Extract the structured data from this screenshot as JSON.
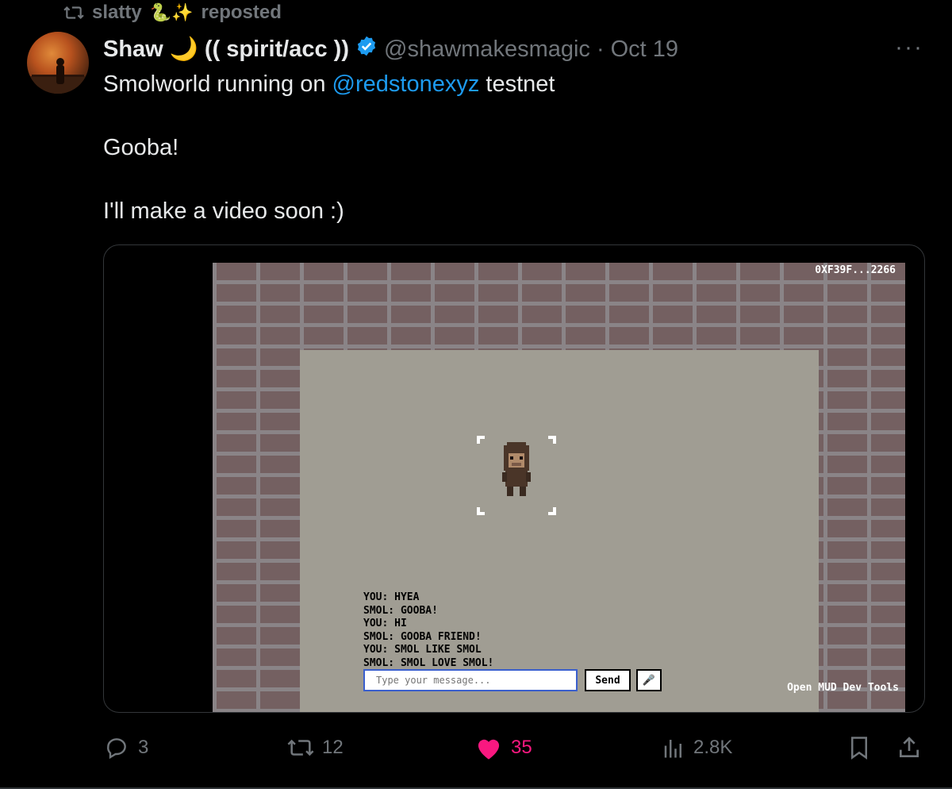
{
  "repost": {
    "user": "slatty",
    "emoji": "🐍✨",
    "label": "reposted"
  },
  "author": {
    "name": "Shaw",
    "name_suffix": "🌙 (( spirit/acc ))",
    "handle": "@shawmakesmagic",
    "separator": "·",
    "date": "Oct 19"
  },
  "tweet": {
    "line1_prefix": "Smolworld running on ",
    "mention": "@redstonexyz",
    "line1_suffix": " testnet",
    "line2": "Gooba!",
    "line3": "I'll make a video soon :)"
  },
  "game": {
    "address": "0XF39F...2266",
    "chat": [
      "YOU: HYEA",
      "SMOL: GOOBA!",
      "YOU: HI",
      "SMOL: GOOBA FRIEND!",
      "YOU: SMOL LIKE SMOL",
      "SMOL: SMOL LOVE SMOL!"
    ],
    "input_placeholder": "Type your message...",
    "send_label": "Send",
    "devtools_label": "Open MUD Dev Tools"
  },
  "actions": {
    "replies": "3",
    "reposts": "12",
    "likes": "35",
    "views": "2.8K"
  },
  "colors": {
    "accent": "#1d9bf0",
    "like": "#f91880",
    "muted": "#71767b",
    "verified": "#1d9bf0"
  }
}
